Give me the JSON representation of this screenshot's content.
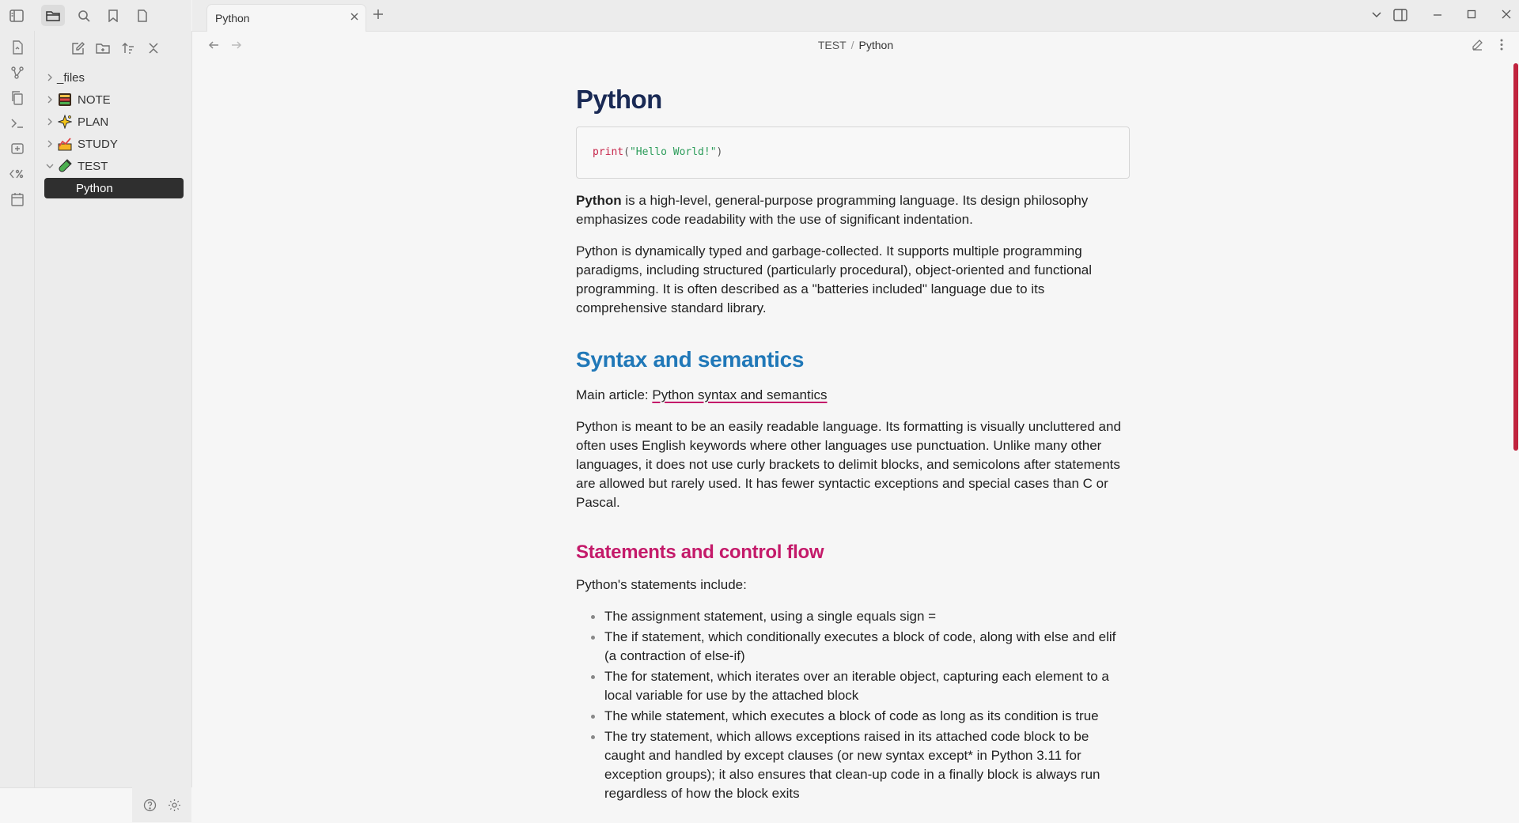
{
  "window": {
    "tab_title": "Python"
  },
  "breadcrumb": {
    "parent": "TEST",
    "separator": "/",
    "current": "Python"
  },
  "sidebar": {
    "folders": [
      {
        "label": "_files",
        "icon": "none"
      },
      {
        "label": "NOTE",
        "icon": "notebook-icon"
      },
      {
        "label": "PLAN",
        "icon": "sparkle-icon"
      },
      {
        "label": "STUDY",
        "icon": "chart-icon"
      },
      {
        "label": "TEST",
        "icon": "test-tube-icon"
      }
    ],
    "selected_file": "Python"
  },
  "note": {
    "title": "Python",
    "code": {
      "fn": "print",
      "open": "(",
      "string": "\"Hello World!\"",
      "close": ")"
    },
    "intro_bold": "Python",
    "intro_rest": " is a high-level, general-purpose programming language. Its design philosophy emphasizes code readability with the use of significant indentation.",
    "para2": "Python is dynamically typed and garbage-collected. It supports multiple programming paradigms, including structured (particularly procedural), object-oriented and functional programming. It is often described as a \"batteries included\" language due to its comprehensive standard library.",
    "section1": {
      "heading": "Syntax and semantics",
      "main_article_prefix": "Main article: ",
      "main_article_link": "Python syntax and semantics",
      "body": "Python is meant to be an easily readable language. Its formatting is visually uncluttered and often uses English keywords where other languages use punctuation. Unlike many other languages, it does not use curly brackets to delimit blocks, and semicolons after statements are allowed but rarely used. It has fewer syntactic exceptions and special cases than C or Pascal."
    },
    "section2": {
      "heading": "Statements and control flow",
      "intro": "Python's statements include:",
      "items": [
        "The assignment statement, using a single equals sign =",
        "The if statement, which conditionally executes a block of code, along with else and elif (a contraction of else-if)",
        "The for statement, which iterates over an iterable object, capturing each element to a local variable for use by the attached block",
        "The while statement, which executes a block of code as long as its condition is true",
        "The try statement, which allows exceptions raised in its attached code block to be caught and handled by except clauses (or new syntax except* in Python 3.11 for exception groups); it also ensures that clean-up code in a finally block is always run regardless of how the block exits"
      ]
    }
  },
  "colors": {
    "accent": "#c41a6a",
    "h1": "#1a2a55",
    "h2": "#2078b8",
    "scroll_thumb": "#c0233e"
  }
}
